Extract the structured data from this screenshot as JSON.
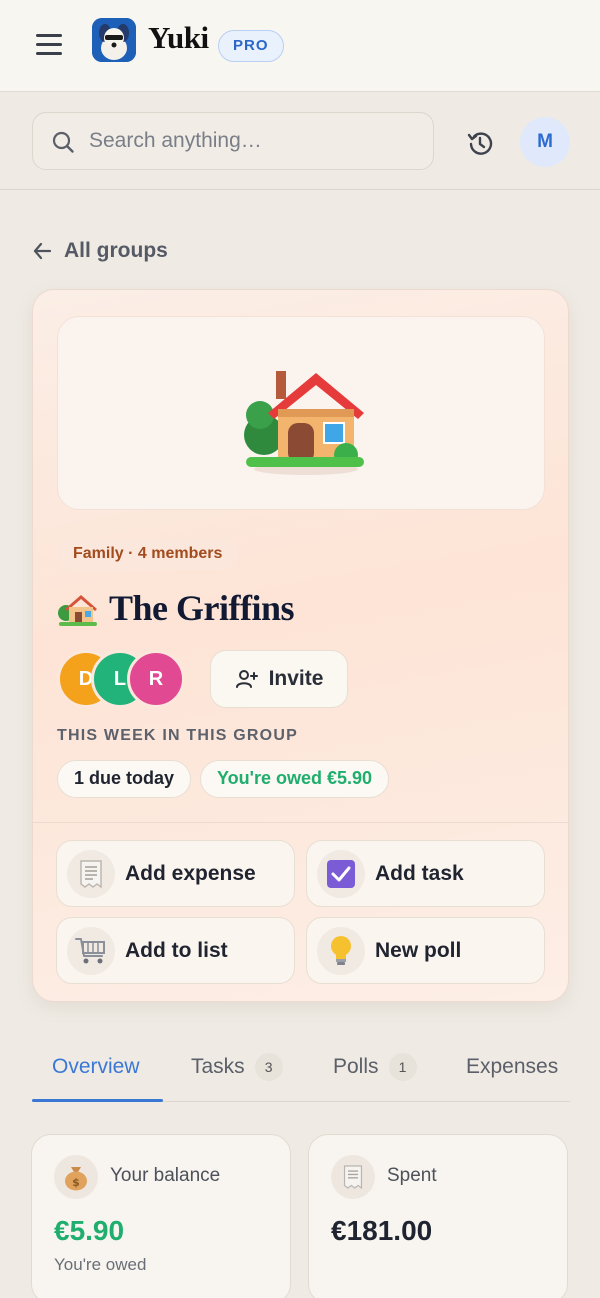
{
  "app": {
    "name": "Yuki",
    "plan_badge": "PRO"
  },
  "search": {
    "placeholder": "Search anything…"
  },
  "user": {
    "avatar_initial": "M"
  },
  "nav": {
    "back_label": "All groups"
  },
  "group": {
    "tag": "Family · 4 members",
    "name": "The Griffins",
    "members": [
      {
        "initial": "D",
        "color": "#f4a21b"
      },
      {
        "initial": "L",
        "color": "#22b37a"
      },
      {
        "initial": "R",
        "color": "#e14a92"
      }
    ],
    "invite_label": "Invite",
    "week_label": "THIS WEEK IN THIS GROUP",
    "chips": {
      "due": "1 due today",
      "owed": "You're owed €5.90"
    },
    "actions": {
      "add_expense": "Add expense",
      "add_task": "Add task",
      "add_to_list": "Add to list",
      "new_poll": "New poll"
    }
  },
  "tabs": {
    "overview": {
      "label": "Overview"
    },
    "tasks": {
      "label": "Tasks",
      "count": "3"
    },
    "polls": {
      "label": "Polls",
      "count": "1"
    },
    "expenses": {
      "label": "Expenses"
    }
  },
  "stats": {
    "balance": {
      "label": "Your balance",
      "value": "€5.90",
      "sub": "You're owed"
    },
    "spent": {
      "label": "Spent",
      "value": "€181.00"
    }
  },
  "colors": {
    "accent": "#3a78d6",
    "positive": "#1fae6e",
    "brand": "#1e5fb8"
  },
  "icons": [
    "menu-icon",
    "search-icon",
    "history-icon",
    "arrow-left-icon",
    "house-icon",
    "person-add-icon",
    "receipt-icon",
    "checkbox-icon",
    "cart-icon",
    "bulb-icon",
    "money-bag-icon"
  ]
}
